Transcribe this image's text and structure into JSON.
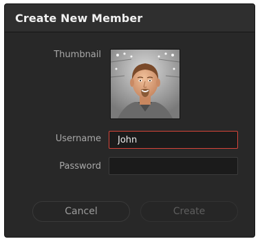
{
  "dialog": {
    "title": "Create New Member"
  },
  "form": {
    "thumbnail_label": "Thumbnail",
    "username_label": "Username",
    "username_value": "John",
    "password_label": "Password",
    "password_value": ""
  },
  "buttons": {
    "cancel_label": "Cancel",
    "create_label": "Create"
  },
  "colors": {
    "dialog_bg": "#282828",
    "title_text": "#f0f0f0",
    "focus_border": "#d8453a",
    "disabled_text": "#5e5e5e"
  }
}
